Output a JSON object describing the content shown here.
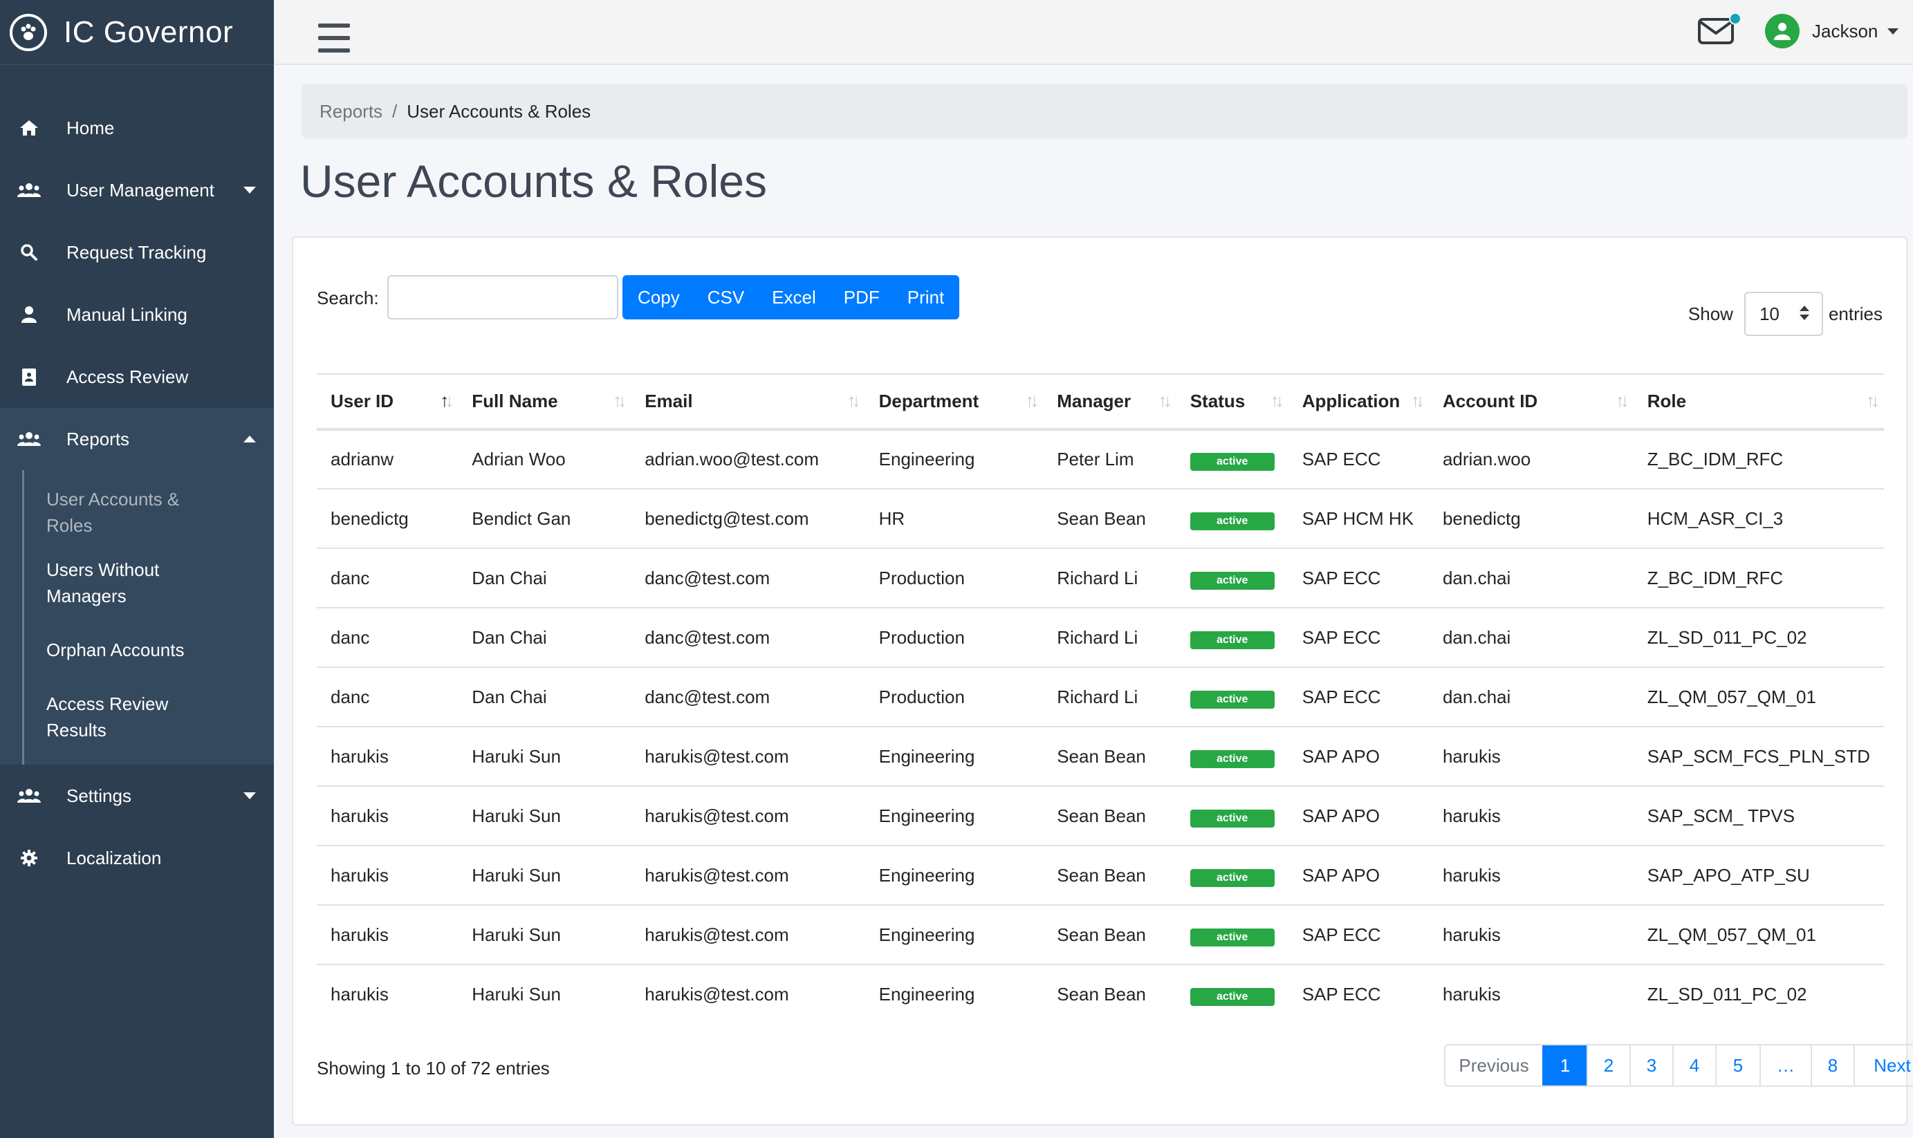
{
  "brand": {
    "name": "IC Governor",
    "icon": "paw-icon"
  },
  "sidebar": {
    "items": [
      {
        "label": "Home",
        "icon": "home-icon"
      },
      {
        "label": "User Management",
        "icon": "users-icon"
      },
      {
        "label": "Request Tracking",
        "icon": "search-icon"
      },
      {
        "label": "Manual Linking",
        "icon": "user-icon"
      },
      {
        "label": "Access Review",
        "icon": "clipboard-icon"
      },
      {
        "label": "Reports",
        "icon": "users-icon"
      },
      {
        "label": "Settings",
        "icon": "users-icon"
      },
      {
        "label": "Localization",
        "icon": "gear-icon"
      }
    ],
    "reports_sub": [
      {
        "label": "User Accounts & Roles"
      },
      {
        "label": "Users Without Managers"
      },
      {
        "label": "Orphan Accounts"
      },
      {
        "label": "Access Review Results"
      }
    ]
  },
  "topbar": {
    "user_name": "Jackson"
  },
  "breadcrumb": {
    "parent": "Reports",
    "separator": "/",
    "current": "User Accounts & Roles"
  },
  "page_title": "User Accounts & Roles",
  "toolbar": {
    "search_label": "Search:",
    "search_value": "",
    "buttons": [
      "Copy",
      "CSV",
      "Excel",
      "PDF",
      "Print"
    ],
    "show_label": "Show",
    "show_value": "10",
    "entries_label": "entries"
  },
  "table": {
    "columns": [
      "User ID",
      "Full Name",
      "Email",
      "Department",
      "Manager",
      "Status",
      "Application",
      "Account ID",
      "Role"
    ],
    "rows": [
      [
        "adrianw",
        "Adrian Woo",
        "adrian.woo@test.com",
        "Engineering",
        "Peter Lim",
        "active",
        "SAP ECC",
        "adrian.woo",
        "Z_BC_IDM_RFC"
      ],
      [
        "benedictg",
        "Bendict Gan",
        "benedictg@test.com",
        "HR",
        "Sean Bean",
        "active",
        "SAP HCM HK",
        "benedictg",
        "HCM_ASR_CI_3"
      ],
      [
        "danc",
        "Dan Chai",
        "danc@test.com",
        "Production",
        "Richard Li",
        "active",
        "SAP ECC",
        "dan.chai",
        "Z_BC_IDM_RFC"
      ],
      [
        "danc",
        "Dan Chai",
        "danc@test.com",
        "Production",
        "Richard Li",
        "active",
        "SAP ECC",
        "dan.chai",
        "ZL_SD_011_PC_02"
      ],
      [
        "danc",
        "Dan Chai",
        "danc@test.com",
        "Production",
        "Richard Li",
        "active",
        "SAP ECC",
        "dan.chai",
        "ZL_QM_057_QM_01"
      ],
      [
        "harukis",
        "Haruki Sun",
        "harukis@test.com",
        "Engineering",
        "Sean Bean",
        "active",
        "SAP APO",
        "harukis",
        "SAP_SCM_FCS_PLN_STD"
      ],
      [
        "harukis",
        "Haruki Sun",
        "harukis@test.com",
        "Engineering",
        "Sean Bean",
        "active",
        "SAP APO",
        "harukis",
        "SAP_SCM_ TPVS"
      ],
      [
        "harukis",
        "Haruki Sun",
        "harukis@test.com",
        "Engineering",
        "Sean Bean",
        "active",
        "SAP APO",
        "harukis",
        "SAP_APO_ATP_SU"
      ],
      [
        "harukis",
        "Haruki Sun",
        "harukis@test.com",
        "Engineering",
        "Sean Bean",
        "active",
        "SAP ECC",
        "harukis",
        "ZL_QM_057_QM_01"
      ],
      [
        "harukis",
        "Haruki Sun",
        "harukis@test.com",
        "Engineering",
        "Sean Bean",
        "active",
        "SAP ECC",
        "harukis",
        "ZL_SD_011_PC_02"
      ]
    ]
  },
  "footer": {
    "info": "Showing 1 to 10 of 72 entries",
    "pages": [
      "Previous",
      "1",
      "2",
      "3",
      "4",
      "5",
      "…",
      "8",
      "Next"
    ],
    "active_page": "1"
  },
  "colors": {
    "sidebar": "#2c3e50",
    "primary": "#007bff",
    "success": "#28a745",
    "notification": "#17a2b8"
  }
}
